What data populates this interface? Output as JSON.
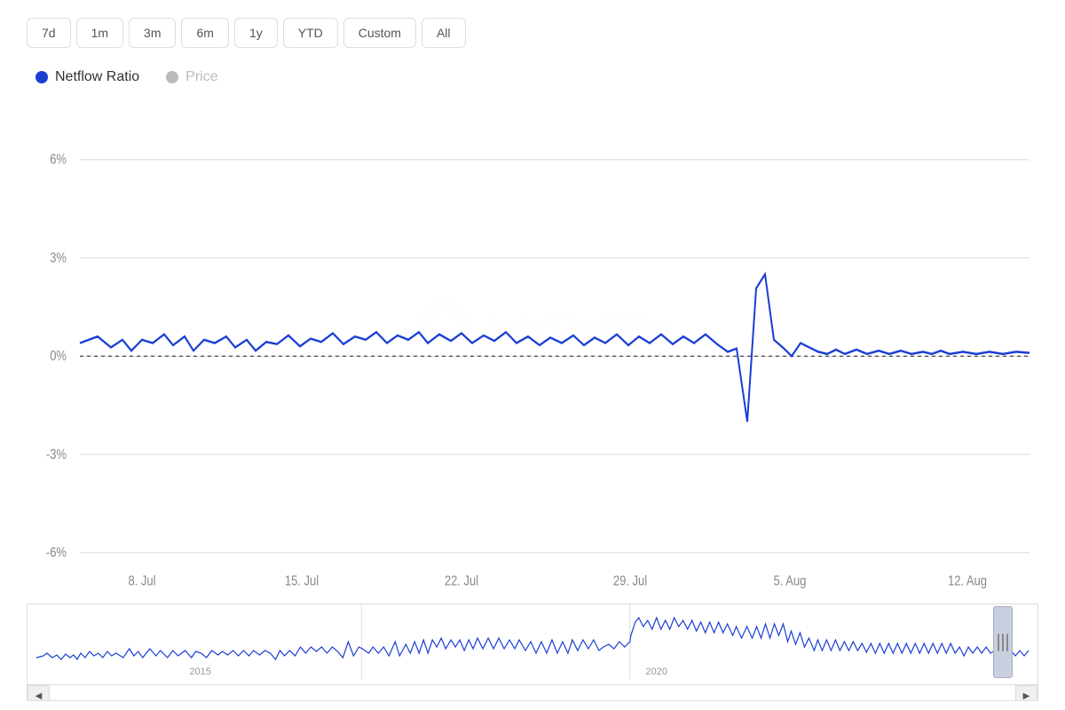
{
  "timeRange": {
    "buttons": [
      {
        "label": "7d",
        "id": "7d"
      },
      {
        "label": "1m",
        "id": "1m"
      },
      {
        "label": "3m",
        "id": "3m"
      },
      {
        "label": "6m",
        "id": "6m"
      },
      {
        "label": "1y",
        "id": "1y"
      },
      {
        "label": "YTD",
        "id": "ytd"
      },
      {
        "label": "Custom",
        "id": "custom"
      },
      {
        "label": "All",
        "id": "all"
      }
    ]
  },
  "legend": {
    "netflowRatio": {
      "label": "Netflow Ratio",
      "color": "#1a3ed4"
    },
    "price": {
      "label": "Price",
      "color": "#bbb"
    }
  },
  "chart": {
    "yAxis": {
      "labels": [
        "6%",
        "3%",
        "0%",
        "-3%",
        "-6%"
      ]
    },
    "xAxis": {
      "labels": [
        "8. Jul",
        "15. Jul",
        "22. Jul",
        "29. Jul",
        "5. Aug",
        "12. Aug"
      ]
    }
  },
  "watermark": "IntoTheBlock",
  "miniChart": {
    "xLabels": [
      "2015",
      "2020"
    ]
  }
}
